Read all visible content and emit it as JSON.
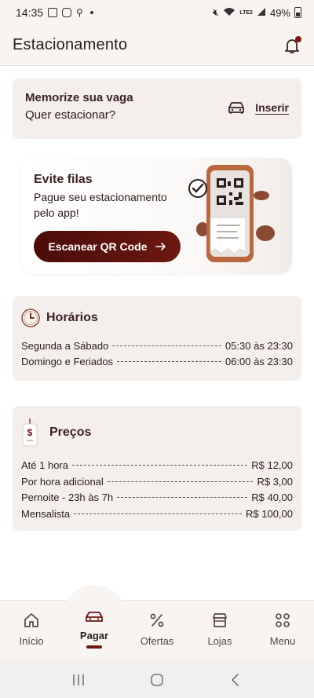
{
  "status_bar": {
    "time": "14:35",
    "battery": "49%",
    "network": "LTE2"
  },
  "header": {
    "title": "Estacionamento"
  },
  "memo_card": {
    "title": "Memorize sua vaga",
    "subtitle": "Quer estacionar?",
    "action_label": "Inserir"
  },
  "qr_card": {
    "title": "Evite filas",
    "text": "Pague seu estacionamento pelo app!",
    "button_label": "Escanear QR Code"
  },
  "hours": {
    "title": "Horários",
    "rows": [
      {
        "label": "Segunda a Sábado",
        "value": "05:30 às 23:30"
      },
      {
        "label": "Domingo e Feriados",
        "value": "06:00 às 23:30"
      }
    ]
  },
  "prices": {
    "title": "Preços",
    "rows": [
      {
        "label": "Até 1 hora",
        "value": "R$ 12,00"
      },
      {
        "label": "Por hora adicional",
        "value": "R$ 3,00"
      },
      {
        "label": "Pernoite - 23h às 7h",
        "value": "R$ 40,00"
      },
      {
        "label": "Mensalista",
        "value": "R$ 100,00"
      }
    ]
  },
  "nav": {
    "items": [
      {
        "label": "Início",
        "icon": "home-icon"
      },
      {
        "label": "Pagar",
        "icon": "car-icon"
      },
      {
        "label": "Ofertas",
        "icon": "percent-icon"
      },
      {
        "label": "Lojas",
        "icon": "store-icon"
      },
      {
        "label": "Menu",
        "icon": "grid-icon"
      }
    ],
    "active_index": 1
  },
  "colors": {
    "brand": "#6b1810",
    "card_bg": "#f4efec",
    "text": "#2a1d1a"
  }
}
